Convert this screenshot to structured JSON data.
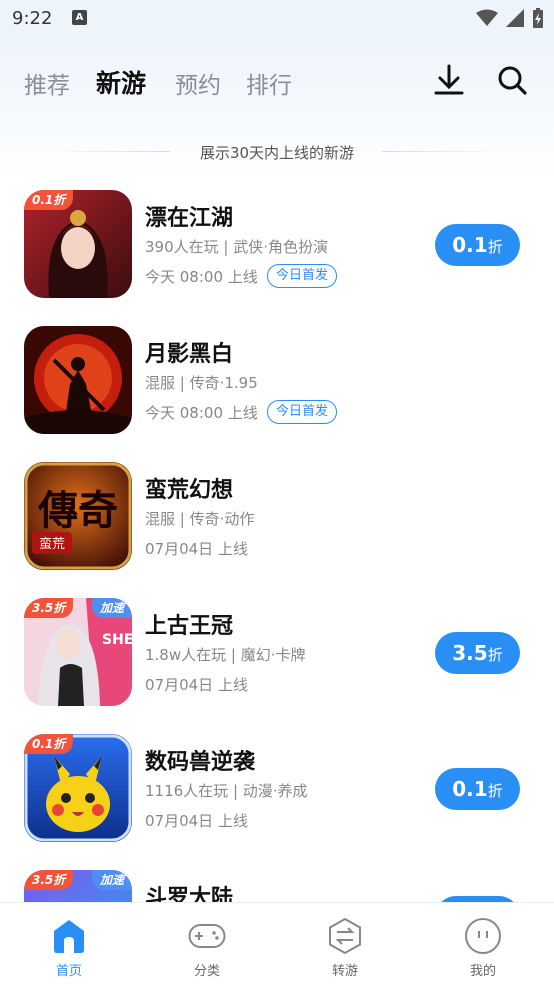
{
  "status": {
    "time": "9:22",
    "app_indicator": "A"
  },
  "tabs": [
    {
      "label": "推荐"
    },
    {
      "label": "新游"
    },
    {
      "label": "预约"
    },
    {
      "label": "排行"
    }
  ],
  "active_tab": "新游",
  "notice": "展示30天内上线的新游",
  "games": [
    {
      "name": "漂在江湖",
      "meta": "390人在玩 | 武侠·角色扮演",
      "date": "今天 08:00 上线",
      "tag": "今日首发",
      "badge": "0.1折",
      "badge2": "",
      "discount_num": "0.1",
      "discount_unit": "折"
    },
    {
      "name": "月影黑白",
      "meta": "混服 | 传奇·1.95",
      "date": "今天 08:00 上线",
      "tag": "今日首发",
      "badge": "",
      "badge2": "",
      "discount_num": "",
      "discount_unit": ""
    },
    {
      "name": "蛮荒幻想",
      "meta": "混服 | 传奇·动作",
      "date": "07月04日 上线",
      "tag": "",
      "badge": "",
      "badge2": "",
      "discount_num": "",
      "discount_unit": ""
    },
    {
      "name": "上古王冠",
      "meta": "1.8w人在玩 | 魔幻·卡牌",
      "date": "07月04日 上线",
      "tag": "",
      "badge": "3.5折",
      "badge2": "加速",
      "discount_num": "3.5",
      "discount_unit": "折"
    },
    {
      "name": "数码兽逆袭",
      "meta": "1116人在玩 | 动漫·养成",
      "date": "07月04日 上线",
      "tag": "",
      "badge": "0.1折",
      "badge2": "",
      "discount_num": "0.1",
      "discount_unit": "折"
    },
    {
      "name": "斗罗大陆",
      "meta": "",
      "date": "",
      "tag": "",
      "badge": "3.5折",
      "badge2": "加速",
      "discount_num": "",
      "discount_unit": ""
    }
  ],
  "icon_art": {
    "game1": "red-haired-warrior-woman",
    "game2": "monkey-king-red-moon",
    "game3": "calligraphy-传奇-蛮荒",
    "game4": "anime-girl-SHE",
    "game5": "pikachu",
    "game6": "purple-fantasy"
  },
  "icon_art_text": {
    "game3_big": "傳奇",
    "game3_small": "蛮荒",
    "game4_logo": "SHE"
  },
  "bottom_nav": [
    {
      "label": "首页",
      "icon": "home-icon"
    },
    {
      "label": "分类",
      "icon": "gamepad-icon"
    },
    {
      "label": "转游",
      "icon": "transfer-hexagon-icon"
    },
    {
      "label": "我的",
      "icon": "profile-face-icon"
    }
  ],
  "colors": {
    "accent": "#2a8ff5",
    "badge_red": "#f1533b",
    "badge_blue": "#4f8ff1"
  }
}
